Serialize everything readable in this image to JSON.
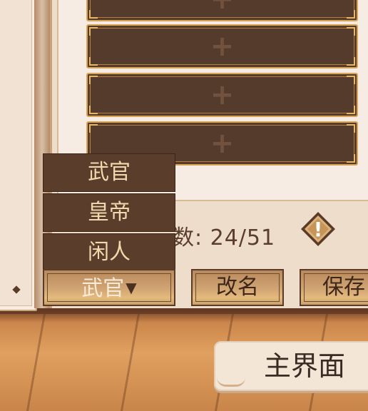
{
  "slots": [
    {
      "plus": "+"
    },
    {
      "plus": "+"
    },
    {
      "plus": "+"
    },
    {
      "plus": "+"
    }
  ],
  "count": {
    "text": "数: 24/51"
  },
  "alert": {
    "symbol": "!"
  },
  "dropdown": {
    "options": [
      "武官",
      "皇帝",
      "闲人"
    ],
    "selected": "武官",
    "arrow": "▼"
  },
  "buttons": {
    "rename": "改名",
    "save": "保存",
    "main": "主界面"
  },
  "colors": {
    "slot_bg": "#553b2c",
    "slot_border": "#d9a457",
    "dropdown_bg": "#5b3d2b",
    "text_dark": "#5a3d2c"
  }
}
